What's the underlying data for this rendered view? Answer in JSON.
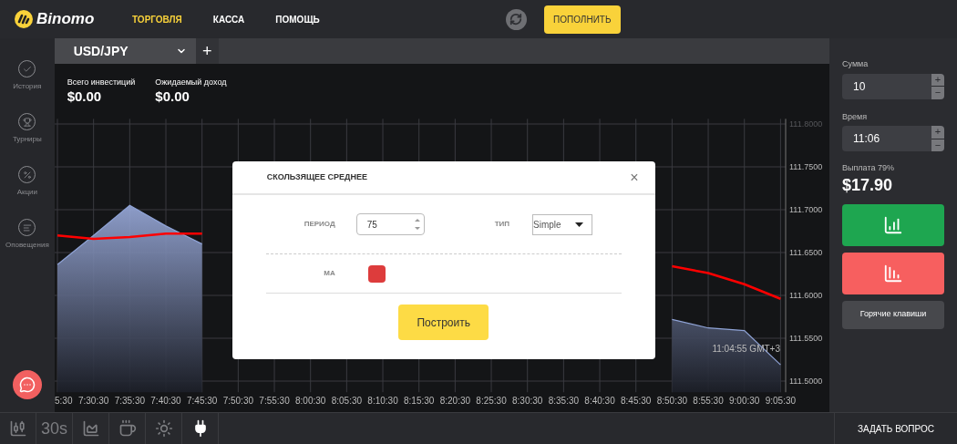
{
  "header": {
    "logo": "Binomo",
    "nav": [
      {
        "label": "ТОРГОВЛЯ",
        "selected": true
      },
      {
        "label": "КАССА",
        "selected": false
      },
      {
        "label": "ПОМОЩЬ",
        "selected": false
      }
    ],
    "deposit_button": "ПОПОЛНИТЬ"
  },
  "sidebar": {
    "items": [
      {
        "label": "История",
        "kind": "history"
      },
      {
        "label": "Турниры",
        "kind": "tournaments"
      },
      {
        "label": "Акции",
        "kind": "promotions"
      },
      {
        "label": "Оповещения",
        "kind": "notifications"
      }
    ]
  },
  "asset_tab": {
    "label": "USD/JPY",
    "add": "+"
  },
  "stats": [
    {
      "label": "Всего инвестиций",
      "value": "$0.00"
    },
    {
      "label": "Ожидаемый доход",
      "value": "$0.00"
    }
  ],
  "chart": {
    "time_label": "11:04:55 GMT+3",
    "chart_data": {
      "type": "area",
      "grid": true,
      "categories": [
        "5:30",
        "7:30:30",
        "7:35:30",
        "7:40:30",
        "7:45:30",
        "7:50:30",
        "7:55:30",
        "8:00:30",
        "8:05:30",
        "8:10:30",
        "8:15:30",
        "8:20:30",
        "8:25:30",
        "8:30:30",
        "8:35:30",
        "8:40:30",
        "8:45:30",
        "8:50:30",
        "8:55:30",
        "9:00:30",
        "9:05:30"
      ],
      "yticks": [
        {
          "value": 111.5,
          "label": "111.5000"
        },
        {
          "value": 111.55,
          "label": "111.5500"
        },
        {
          "value": 111.6,
          "label": "111.6000"
        },
        {
          "value": 111.65,
          "label": "111.6500"
        },
        {
          "value": 111.7,
          "label": "111.7000"
        },
        {
          "value": 111.75,
          "label": "111.7500"
        },
        {
          "value": 111.8,
          "label": "111.8000"
        }
      ],
      "ylim": [
        111.487,
        111.806
      ],
      "series": [
        {
          "type": "area",
          "color": "#8fa3d6",
          "values": [
            111.636,
            111.67,
            111.705,
            111.681,
            111.66,
            null,
            null,
            null,
            null,
            null,
            null,
            null,
            null,
            null,
            null,
            null,
            null,
            111.572,
            111.562,
            111.559,
            111.519
          ]
        },
        {
          "type": "line",
          "color": "#ff0000",
          "values": [
            111.67,
            111.666,
            111.668,
            111.672,
            111.672,
            null,
            null,
            null,
            null,
            null,
            null,
            null,
            null,
            null,
            null,
            null,
            null,
            111.634,
            111.626,
            111.613,
            111.596
          ]
        }
      ]
    }
  },
  "modal": {
    "title": "СКОЛЬЗЯЩЕЕ СРЕДНЕЕ",
    "close": "×",
    "period_label": "ПЕРИОД",
    "period": "75",
    "type_label": "ТИП",
    "type": "Simple",
    "ma": {
      "label": "МА",
      "color": "#dd3c3c"
    },
    "submit": "Построить"
  },
  "trade_panel": {
    "amount_label": "Сумма",
    "amount": "10",
    "time_label": "Время",
    "time": "11:06",
    "plus": "+",
    "minus": "−",
    "payout_label": "Выплата 79%",
    "payout": "$17.90",
    "hotkeys_button": "Горячие клавиши"
  },
  "toolbar": [
    {
      "kind": "candles",
      "selected": false
    },
    {
      "kind": "label",
      "text": "30s",
      "selected": false
    },
    {
      "kind": "line",
      "selected": false
    },
    {
      "kind": "coffee",
      "selected": false
    },
    {
      "kind": "sun",
      "selected": false
    },
    {
      "kind": "plug",
      "selected": true
    }
  ],
  "ask_button": "ЗАДАТЬ ВОПРОС"
}
